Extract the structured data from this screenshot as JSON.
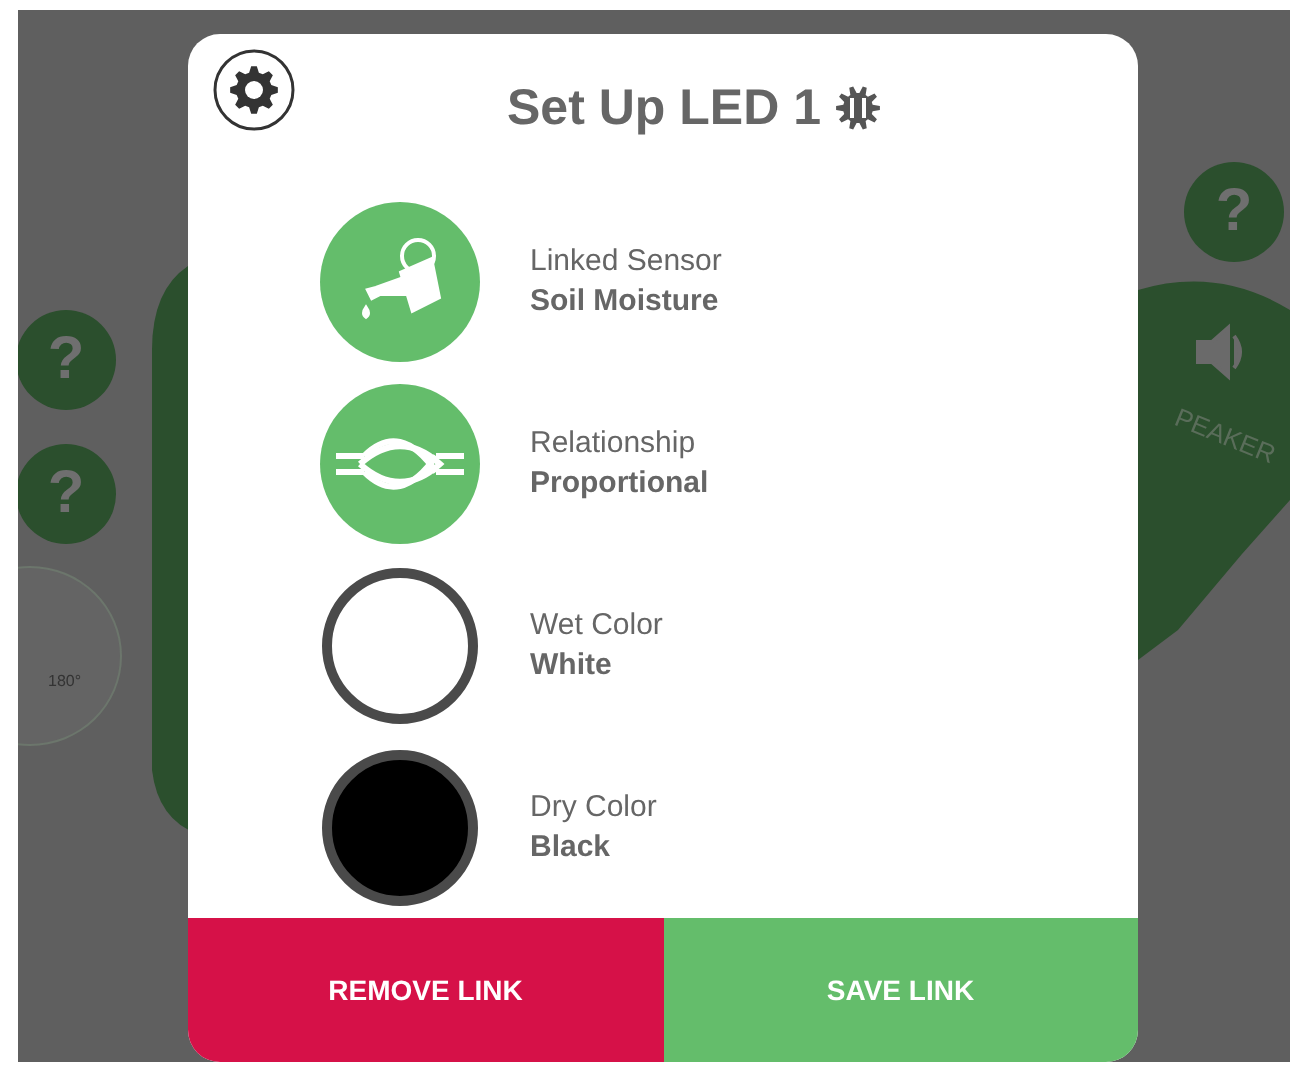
{
  "background": {
    "help_buttons": [
      "?",
      "?",
      "?"
    ],
    "speaker_label": "PEAKER",
    "dial_reading": "180°"
  },
  "dialog": {
    "title": "Set Up LED 1",
    "rows": [
      {
        "kind": "sensor",
        "label": "Linked Sensor",
        "value": "Soil Moisture"
      },
      {
        "kind": "relationship",
        "label": "Relationship",
        "value": "Proportional"
      },
      {
        "kind": "color",
        "label": "Wet Color",
        "value": "White",
        "color": "#ffffff"
      },
      {
        "kind": "color",
        "label": "Dry Color",
        "value": "Black",
        "color": "#000000"
      }
    ],
    "buttons": [
      {
        "kind": "danger",
        "label": "REMOVE LINK"
      },
      {
        "kind": "primary",
        "label": "SAVE LINK"
      }
    ]
  }
}
